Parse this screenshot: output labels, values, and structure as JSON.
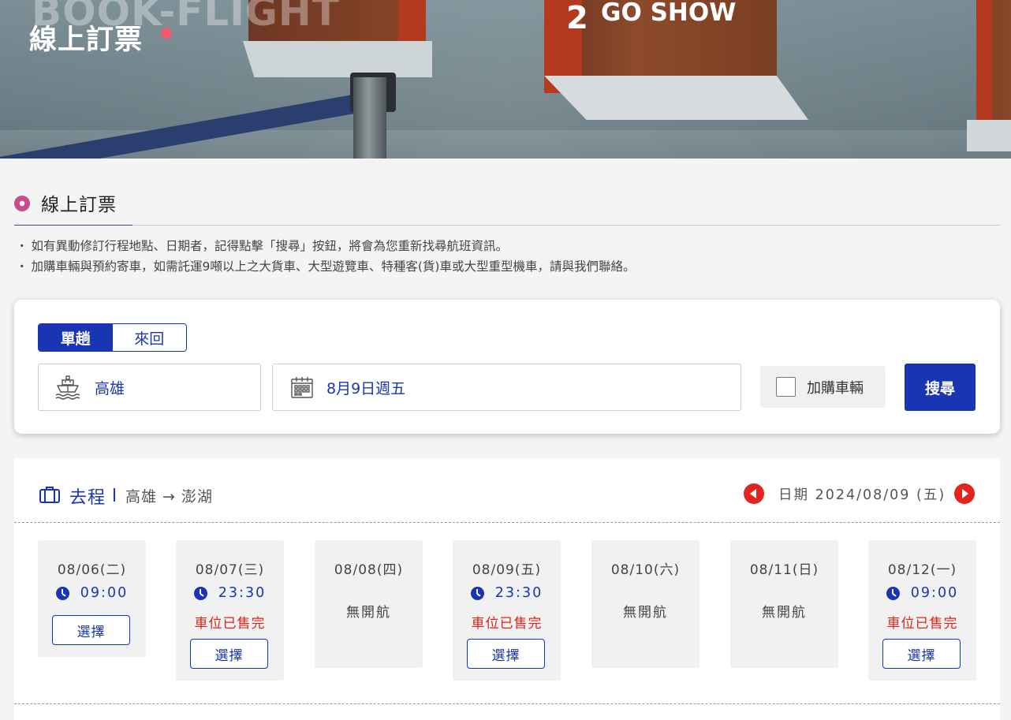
{
  "hero": {
    "title": "線上訂票",
    "ghost_text": "BOOK-FLIGHT",
    "sign_number": "2",
    "sign_text": "GO SHOW"
  },
  "section": {
    "title": "線上訂票",
    "notes": [
      "如有異動修訂行程地點、日期者，記得點擊「搜尋」按鈕，將會為您重新找尋航班資訊。",
      "加購車輛與預約寄車，如需託運9噸以上之大貨車、大型遊覽車、特種客(貨)車或大型重型機車，請與我們聯絡。"
    ]
  },
  "search": {
    "trip_one_way": "單趟",
    "trip_round": "來回",
    "port": "高雄",
    "date": "8月9日週五",
    "vehicle_label": "加購車輛",
    "vehicle_checked": false,
    "search_label": "搜尋"
  },
  "results": {
    "direction": "去程",
    "route": "高雄 → 澎湖",
    "date_label": "日期 2024/08/09 (五)",
    "days": [
      {
        "date": "08/06(二)",
        "time": "09:00",
        "status": "",
        "select": "選擇",
        "none": ""
      },
      {
        "date": "08/07(三)",
        "time": "23:30",
        "status": "車位已售完",
        "select": "選擇",
        "none": ""
      },
      {
        "date": "08/08(四)",
        "time": "",
        "status": "",
        "select": "",
        "none": "無開航"
      },
      {
        "date": "08/09(五)",
        "time": "23:30",
        "status": "車位已售完",
        "select": "選擇",
        "none": ""
      },
      {
        "date": "08/10(六)",
        "time": "",
        "status": "",
        "select": "",
        "none": "無開航"
      },
      {
        "date": "08/11(日)",
        "time": "",
        "status": "",
        "select": "",
        "none": "無開航"
      },
      {
        "date": "08/12(一)",
        "time": "09:00",
        "status": "車位已售完",
        "select": "選擇",
        "none": ""
      }
    ]
  },
  "colors": {
    "brand_blue": "#1a35b4",
    "sold_out_red": "#d9261c",
    "nav_red": "#e2241f",
    "accent_pink": "#ef5b6e"
  }
}
